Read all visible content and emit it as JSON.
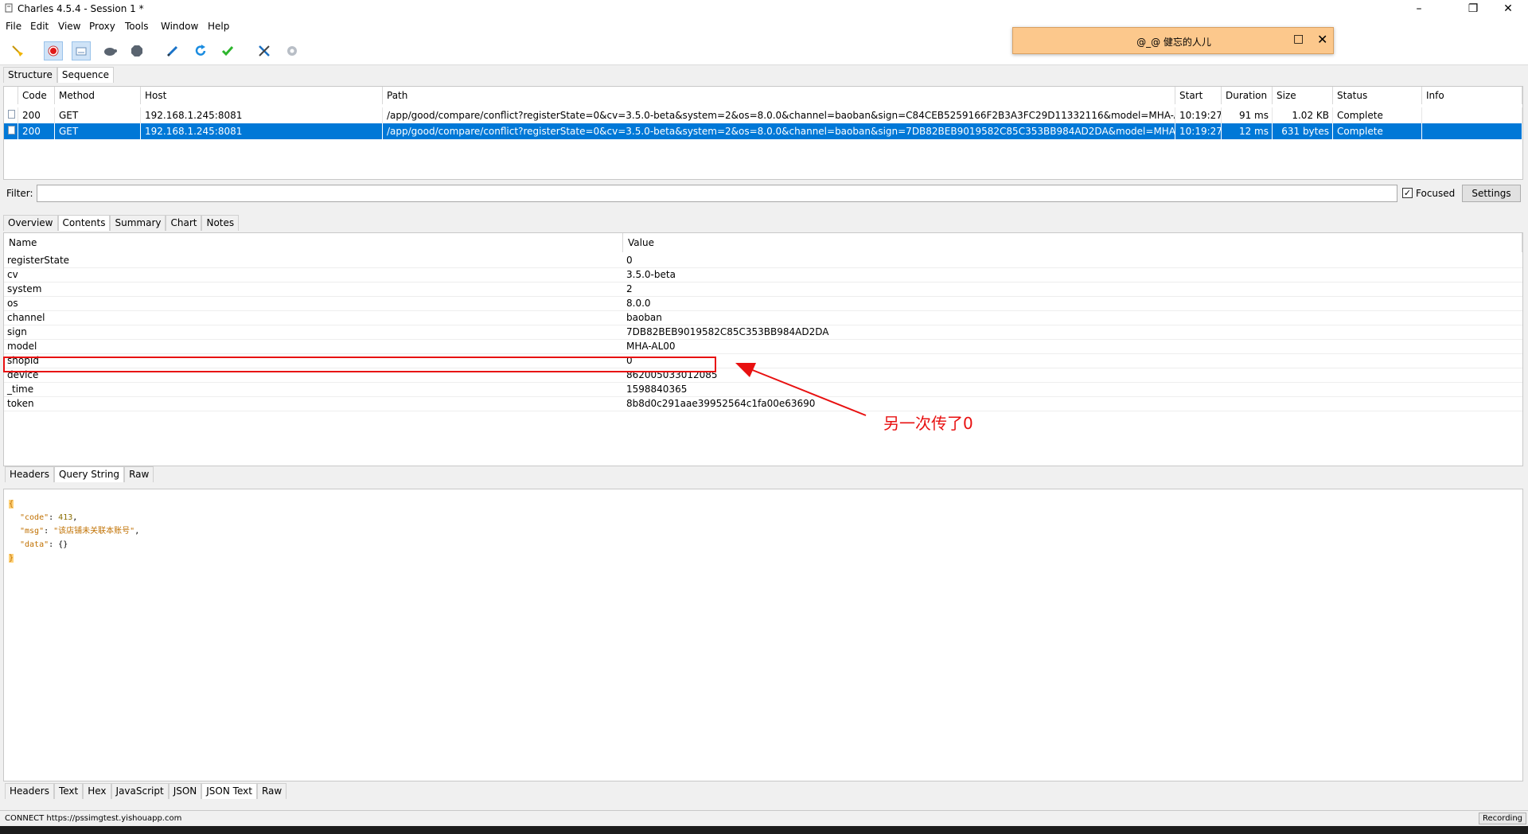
{
  "window": {
    "title": "Charles 4.5.4 - Session 1 *"
  },
  "menu": [
    "File",
    "Edit",
    "View",
    "Proxy",
    "Tools",
    "Window",
    "Help"
  ],
  "popup": {
    "text": "@_@  健忘的人儿"
  },
  "view_tabs": [
    "Structure",
    "Sequence"
  ],
  "sequence": {
    "columns": [
      "Code",
      "Method",
      "Host",
      "Path",
      "Start",
      "Duration",
      "Size",
      "Status",
      "Info"
    ],
    "rows": [
      {
        "code": "200",
        "method": "GET",
        "host": "192.168.1.245:8081",
        "path": "/app/good/compare/conflict?registerState=0&cv=3.5.0-beta&system=2&os=8.0.0&channel=baoban&sign=C84CEB5259166F2B3A3FC29D11332116&model=MHA-AL0...",
        "start": "10:19:27",
        "duration": "91 ms",
        "size": "1.02 KB",
        "status": "Complete",
        "info": ""
      },
      {
        "code": "200",
        "method": "GET",
        "host": "192.168.1.245:8081",
        "path": "/app/good/compare/conflict?registerState=0&cv=3.5.0-beta&system=2&os=8.0.0&channel=baoban&sign=7DB82BEB9019582C85C353BB984AD2DA&model=MHA-AL...",
        "start": "10:19:27",
        "duration": "12 ms",
        "size": "631 bytes",
        "status": "Complete",
        "info": ""
      }
    ]
  },
  "filter": {
    "label": "Filter:",
    "value": "",
    "focused_label": "Focused",
    "settings_label": "Settings"
  },
  "detail_tabs": [
    "Overview",
    "Contents",
    "Summary",
    "Chart",
    "Notes"
  ],
  "params": {
    "columns": [
      "Name",
      "Value"
    ],
    "rows": [
      {
        "name": "registerState",
        "value": "0"
      },
      {
        "name": "cv",
        "value": "3.5.0-beta"
      },
      {
        "name": "system",
        "value": "2"
      },
      {
        "name": "os",
        "value": "8.0.0"
      },
      {
        "name": "channel",
        "value": "baoban"
      },
      {
        "name": "sign",
        "value": "7DB82BEB9019582C85C353BB984AD2DA"
      },
      {
        "name": "model",
        "value": "MHA-AL00"
      },
      {
        "name": "shopId",
        "value": "0"
      },
      {
        "name": "device",
        "value": "862005033012085"
      },
      {
        "name": "_time",
        "value": "1598840365"
      },
      {
        "name": "token",
        "value": "8b8d0c291aae39952564c1fa00e63690"
      }
    ]
  },
  "annotation": {
    "text": "另一次传了0",
    "color": "#e81010"
  },
  "request_tabs": [
    "Headers",
    "Query String",
    "Raw"
  ],
  "response": {
    "open": "{",
    "lines": [
      {
        "key": "\"code\"",
        "sep": ": ",
        "val": "413",
        "end": ","
      },
      {
        "key": "\"msg\"",
        "sep": ": ",
        "val": "\"该店铺未关联本账号\"",
        "end": ","
      },
      {
        "key": "\"data\"",
        "sep": ": ",
        "val": "{}",
        "end": ""
      }
    ],
    "close": "}"
  },
  "response_tabs": [
    "Headers",
    "Text",
    "Hex",
    "JavaScript",
    "JSON",
    "JSON Text",
    "Raw"
  ],
  "status": {
    "left": "CONNECT https://pssimgtest.yishouapp.com",
    "right": "Recording"
  },
  "colors": {
    "selection": "#0078d7",
    "popup": "#fcc88c",
    "annotation": "#e81010"
  }
}
